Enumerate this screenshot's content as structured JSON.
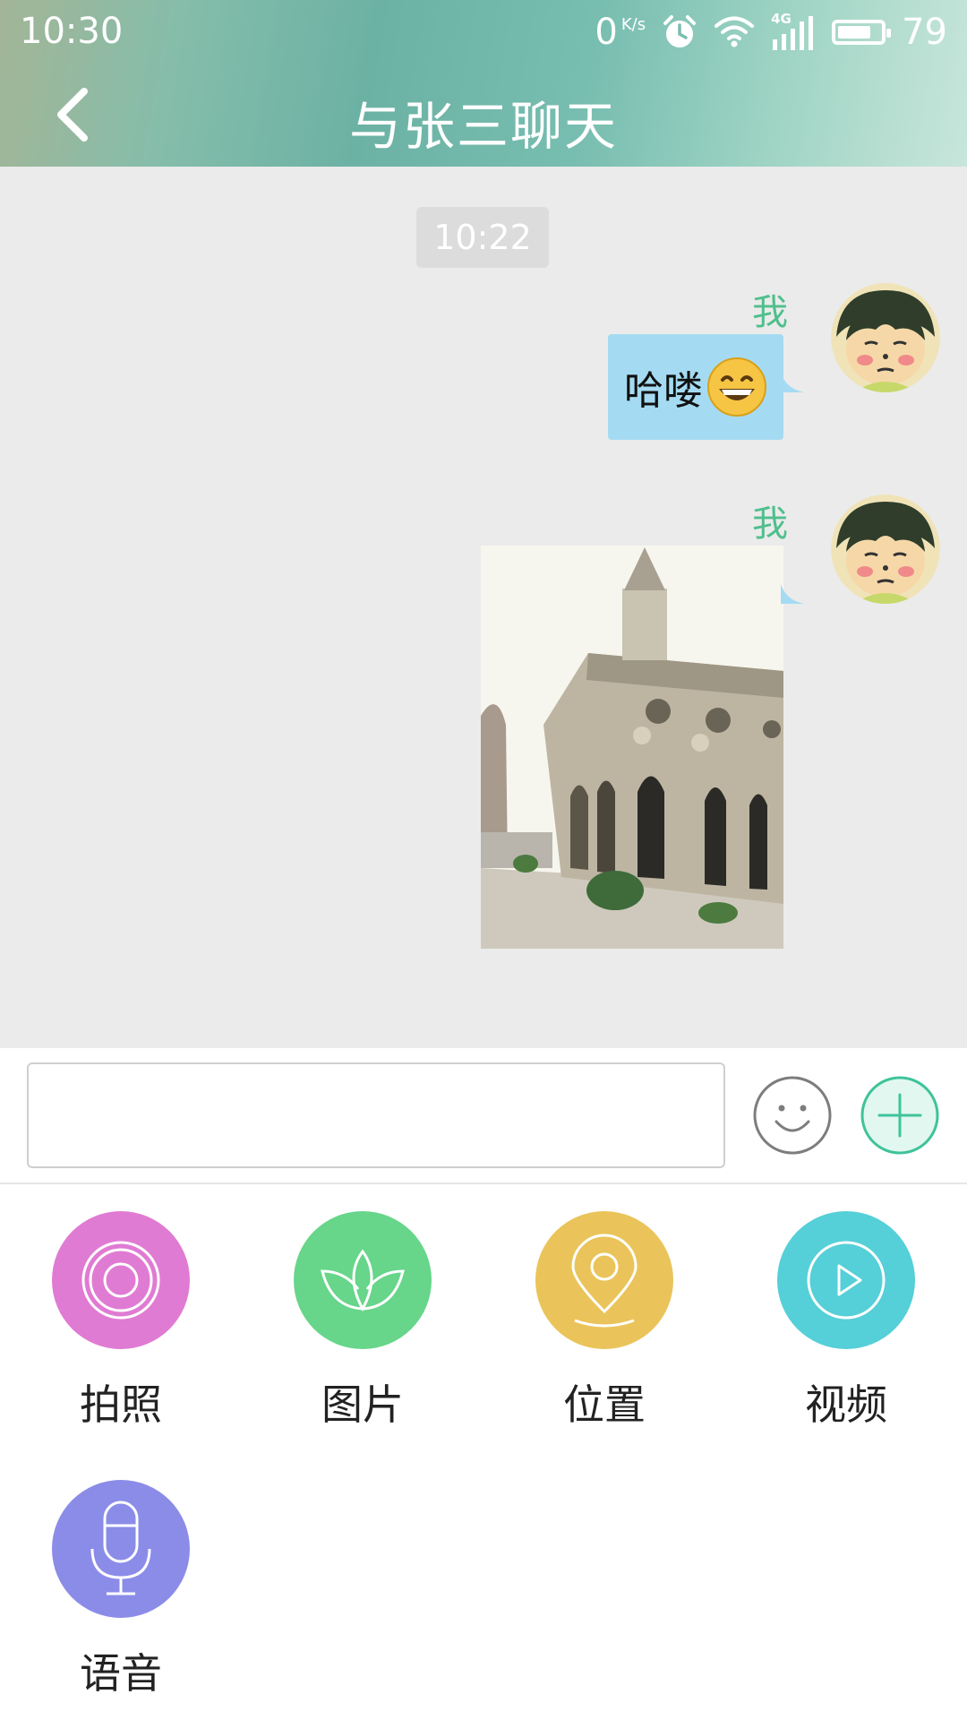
{
  "status_bar": {
    "time": "10:30",
    "net_speed_value": "0",
    "net_speed_unit": "K/s",
    "network_label": "4G",
    "battery": "79",
    "battery_fraction": 0.79
  },
  "header": {
    "title": "与张三聊天",
    "back_icon": "chevron-left-icon",
    "gradient_colors": [
      "#a3b596",
      "#6cb2a4",
      "#c8e6db"
    ]
  },
  "chat": {
    "background": "#ebebeb",
    "timestamp": "10:22",
    "messages": [
      {
        "sender": "我",
        "type": "text",
        "text": "哈喽",
        "emoji": "grinning-face",
        "bubble_color": "#a5dbf2"
      },
      {
        "sender": "我",
        "type": "image",
        "image_subject": "gothic-stone-church-photo"
      }
    ]
  },
  "input": {
    "value": "",
    "placeholder": "",
    "emoji_button_icon": "smiley-face-icon",
    "plus_button_icon": "plus-circle-icon",
    "accent_color": "#3ec39a"
  },
  "actions": [
    {
      "label": "拍照",
      "icon": "camera-lens-icon",
      "color": "#e07bd3"
    },
    {
      "label": "图片",
      "icon": "lotus-icon",
      "color": "#67d58a"
    },
    {
      "label": "位置",
      "icon": "location-pin-icon",
      "color": "#eac45a"
    },
    {
      "label": "视频",
      "icon": "play-icon",
      "color": "#55cfd8"
    },
    {
      "label": "语音",
      "icon": "microphone-icon",
      "color": "#8b8ce8"
    }
  ]
}
